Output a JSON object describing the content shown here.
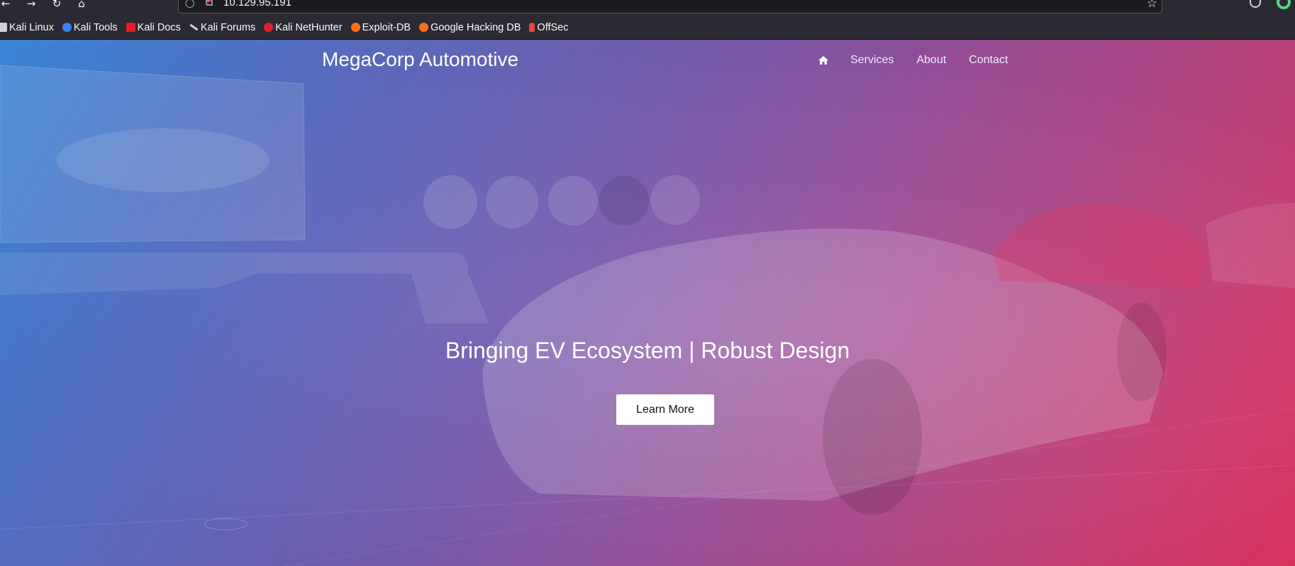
{
  "browser": {
    "url": "10.129.95.191",
    "bookmarks": [
      {
        "label": "Kali Linux",
        "icon": "kali-dragon-icon",
        "color": "#cfcfd8"
      },
      {
        "label": "Kali Tools",
        "icon": "kali-tools-icon",
        "color": "#3b82f6"
      },
      {
        "label": "Kali Docs",
        "icon": "kali-docs-icon",
        "color": "#e11d2e"
      },
      {
        "label": "Kali Forums",
        "icon": "kali-forums-icon",
        "color": "#cfcfd8"
      },
      {
        "label": "Kali NetHunter",
        "icon": "nethunter-icon",
        "color": "#e11d2e"
      },
      {
        "label": "Exploit-DB",
        "icon": "exploit-db-icon",
        "color": "#f97316"
      },
      {
        "label": "Google Hacking DB",
        "icon": "ghdb-icon",
        "color": "#f97316"
      },
      {
        "label": "OffSec",
        "icon": "offsec-icon",
        "color": "#ef4444"
      }
    ]
  },
  "site": {
    "brand": "MegaCorp Automotive",
    "nav": {
      "home_icon": "home-icon",
      "items": [
        "Services",
        "About",
        "Contact"
      ]
    },
    "hero": {
      "tagline": "Bringing EV Ecosystem | Robust Design",
      "cta_label": "Learn More"
    }
  },
  "colors": {
    "gradient_start": "#3c8ae2",
    "gradient_end": "#e23563",
    "browser_chrome": "#2b2a33"
  }
}
